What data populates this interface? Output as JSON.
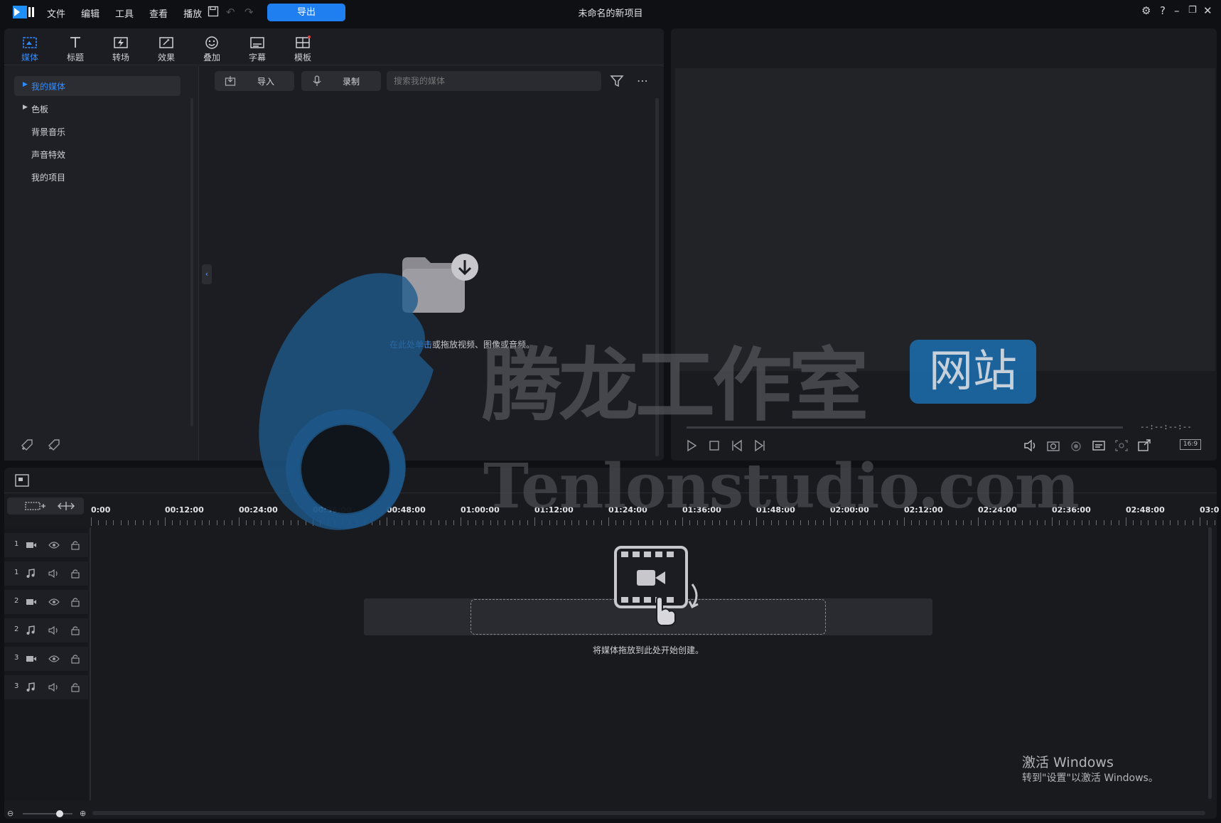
{
  "app": {
    "title": "未命名的新项目",
    "menu": [
      "文件",
      "编辑",
      "工具",
      "查看",
      "播放"
    ],
    "export_label": "导出"
  },
  "library_tabs": [
    {
      "label": "媒体",
      "icon": "media-icon",
      "active": true
    },
    {
      "label": "标题",
      "icon": "title-icon"
    },
    {
      "label": "转场",
      "icon": "transition-icon"
    },
    {
      "label": "效果",
      "icon": "effects-icon"
    },
    {
      "label": "叠加",
      "icon": "overlay-icon"
    },
    {
      "label": "字幕",
      "icon": "subtitle-icon"
    },
    {
      "label": "模板",
      "icon": "template-icon"
    }
  ],
  "sidebar": {
    "items": [
      {
        "label": "我的媒体",
        "expandable": true,
        "selected": true
      },
      {
        "label": "色板",
        "expandable": true
      },
      {
        "label": "背景音乐"
      },
      {
        "label": "声音特效"
      },
      {
        "label": "我的项目"
      }
    ]
  },
  "media_toolbar": {
    "import_label": "导入",
    "record_label": "录制",
    "search_placeholder": "搜索我的媒体"
  },
  "media_empty": {
    "link_text": "在此处单击",
    "rest_text": "或拖放视频、图像或音频。"
  },
  "preview": {
    "timecode": "--:--:--:--",
    "aspect": "16:9"
  },
  "timeline": {
    "ticks": [
      "0:00",
      "00:12:00",
      "00:24:00",
      "00:36:00",
      "00:48:00",
      "01:00:00",
      "01:12:00",
      "01:24:00",
      "01:36:00",
      "01:48:00",
      "02:00:00",
      "02:12:00",
      "02:24:00",
      "02:36:00",
      "02:48:00",
      "03:0"
    ],
    "tracks": [
      {
        "num": "1",
        "type": "video"
      },
      {
        "num": "1",
        "type": "audio"
      },
      {
        "num": "2",
        "type": "video"
      },
      {
        "num": "2",
        "type": "audio"
      },
      {
        "num": "3",
        "type": "video"
      },
      {
        "num": "3",
        "type": "audio"
      }
    ],
    "drop_hint": "将媒体拖放到此处开始创建。"
  },
  "watermark": {
    "cn_text": "腾龙工作室",
    "badge_text": "网站",
    "en_text": "Tenlonstudio.com"
  },
  "activation": {
    "title": "激活 Windows",
    "subtitle": "转到\"设置\"以激活 Windows。"
  },
  "colors": {
    "accent": "#1f7ff0",
    "panel": "#1c1d22",
    "background": "#0f1013"
  }
}
